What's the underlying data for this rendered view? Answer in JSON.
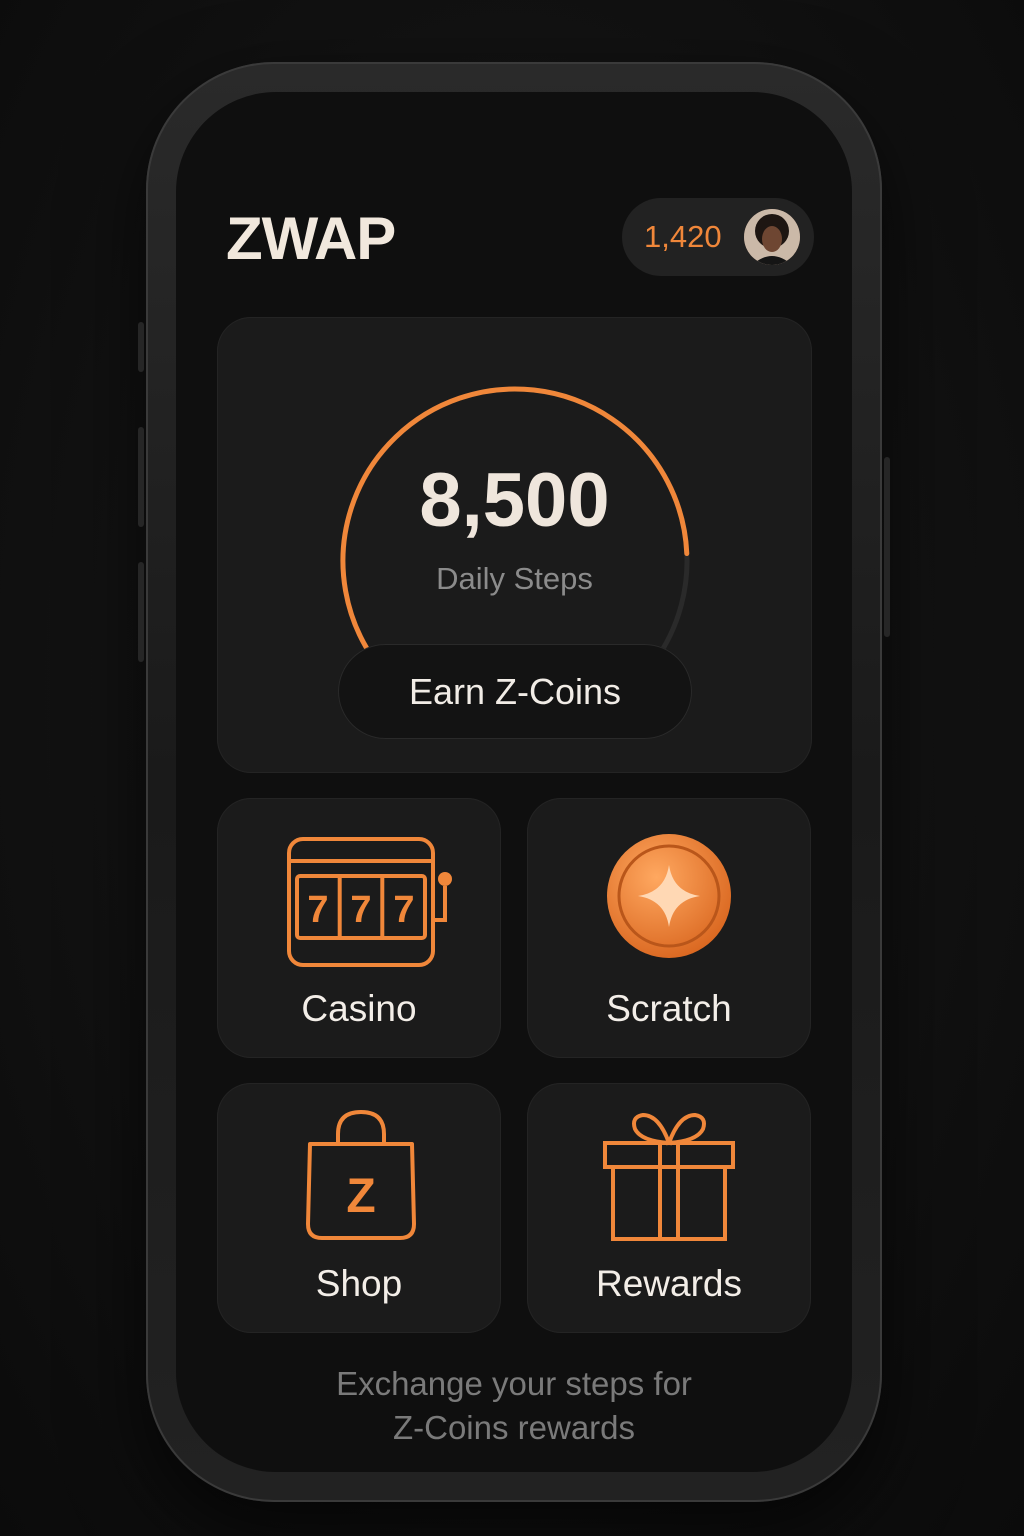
{
  "app": {
    "logo": "ZWAP"
  },
  "header": {
    "coin_balance": "1,420"
  },
  "steps": {
    "count": "8,500",
    "label": "Daily Steps",
    "progress_fraction": 0.85,
    "cta_label": "Earn Z-Coins"
  },
  "tiles": [
    {
      "label": "Casino",
      "icon": "slot-machine-icon"
    },
    {
      "label": "Scratch",
      "icon": "coin-sparkle-icon"
    },
    {
      "label": "Shop",
      "icon": "shopping-bag-icon"
    },
    {
      "label": "Rewards",
      "icon": "gift-icon"
    }
  ],
  "footer": {
    "line1": "Exchange your steps for",
    "line2": "Z-Coins rewards"
  },
  "colors": {
    "accent": "#f0873a",
    "background": "#0f0f0f",
    "card": "#1b1b1b",
    "text": "#f1ece6",
    "muted": "#8b8b8b"
  }
}
